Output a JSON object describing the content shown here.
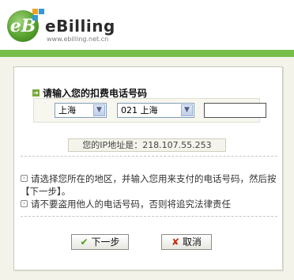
{
  "brand": {
    "logo_text": "eB",
    "name": "eBilling",
    "url": "www.ebilling.net.cn"
  },
  "form": {
    "title": "请输入您的扣费电话号码",
    "province_select": {
      "selected": "上海"
    },
    "city_select": {
      "selected": "021 上海"
    },
    "phone_input": {
      "value": ""
    },
    "ip_text": "您的IP地址是：218.107.55.253"
  },
  "notes": [
    "请选择您所在的地区，并输入您用来支付的电话号码，然后按【下一步】。",
    "请不要盗用他人的电话号码，否则将追究法律责任"
  ],
  "buttons": {
    "next_label": "下一步",
    "cancel_label": "取消"
  },
  "colors": {
    "brand_green": "#76bd4a",
    "panel_bg": "#f3f3ea",
    "next_icon": "#4b9a23",
    "cancel_icon": "#c62b14"
  },
  "icons": {
    "title_arrow": "arrow-right-icon",
    "note_arrow": "arrow-right-icon",
    "next": "check-icon",
    "cancel": "x-icon"
  }
}
